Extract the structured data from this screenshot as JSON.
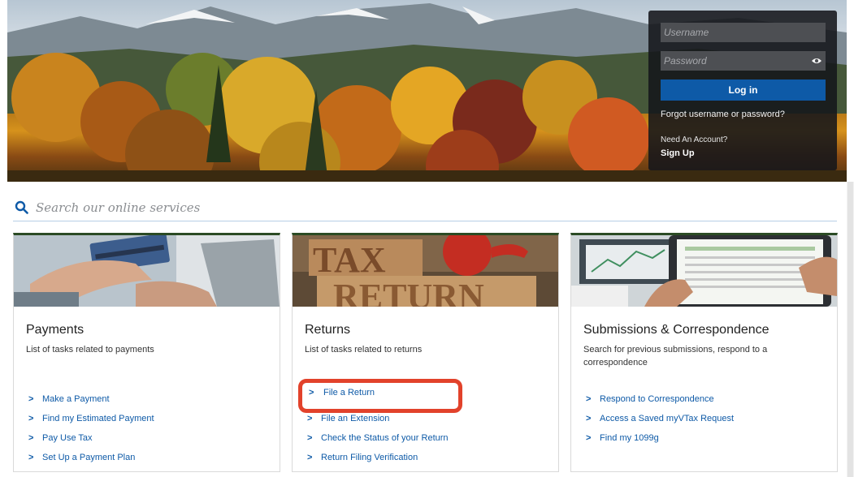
{
  "login": {
    "username_placeholder": "Username",
    "password_placeholder": "Password",
    "login_label": "Log in",
    "forgot_label": "Forgot username or password?",
    "need_account": "Need An Account?",
    "signup_label": "Sign Up"
  },
  "search": {
    "placeholder": "Search our online services",
    "icon": "search-icon"
  },
  "cards": [
    {
      "title": "Payments",
      "description": "List of tasks related to payments",
      "links": [
        "Make a Payment",
        "Find my Estimated Payment",
        "Pay Use Tax",
        "Set Up a Payment Plan"
      ]
    },
    {
      "title": "Returns",
      "description": "List of tasks related to returns",
      "links": [
        "File a Return",
        "File an Extension",
        "Check the Status of your Return",
        "Return Filing Verification"
      ]
    },
    {
      "title": "Submissions & Correspondence",
      "description": "Search for previous submissions, respond to a correspondence",
      "links": [
        "Respond to Correspondence",
        "Access a Saved myVTax Request",
        "Find my 1099g"
      ]
    }
  ],
  "colors": {
    "accent": "#0e5aa7",
    "highlight": "#e2422b",
    "card_top_border": "#2b4b24"
  }
}
